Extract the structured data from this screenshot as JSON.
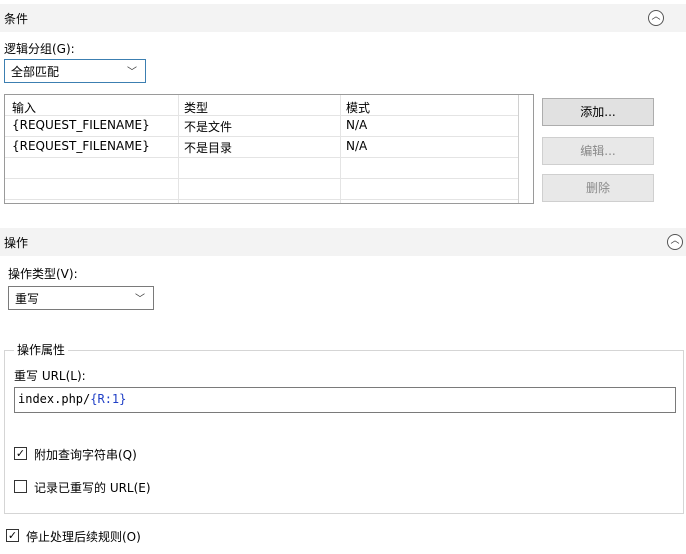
{
  "conditions": {
    "section_title": "条件",
    "logical_grouping_label": "逻辑分组(G):",
    "logical_grouping_value": "全部匹配",
    "columns": [
      "输入",
      "类型",
      "模式"
    ],
    "rows": [
      {
        "input": "{REQUEST_FILENAME}",
        "type": "不是文件",
        "pattern": "N/A"
      },
      {
        "input": "{REQUEST_FILENAME}",
        "type": "不是目录",
        "pattern": "N/A"
      }
    ],
    "buttons": {
      "add": "添加...",
      "edit": "编辑...",
      "remove": "删除"
    }
  },
  "action": {
    "section_title": "操作",
    "action_type_label": "操作类型(V):",
    "action_type_value": "重写",
    "properties_title": "操作属性",
    "rewrite_url_label": "重写 URL(L):",
    "rewrite_url_prefix": "index.php/",
    "rewrite_url_var": "{R:1}",
    "append_query_label": "附加查询字符串(Q)",
    "append_query_checked": true,
    "log_rewritten_label": "记录已重写的 URL(E)",
    "log_rewritten_checked": false,
    "stop_processing_label": "停止处理后续规则(O)",
    "stop_processing_checked": true
  },
  "icons": {
    "collapse": "chevron-up-circle-icon",
    "dropdown": "chevron-down-icon",
    "check": "checkmark-icon"
  }
}
